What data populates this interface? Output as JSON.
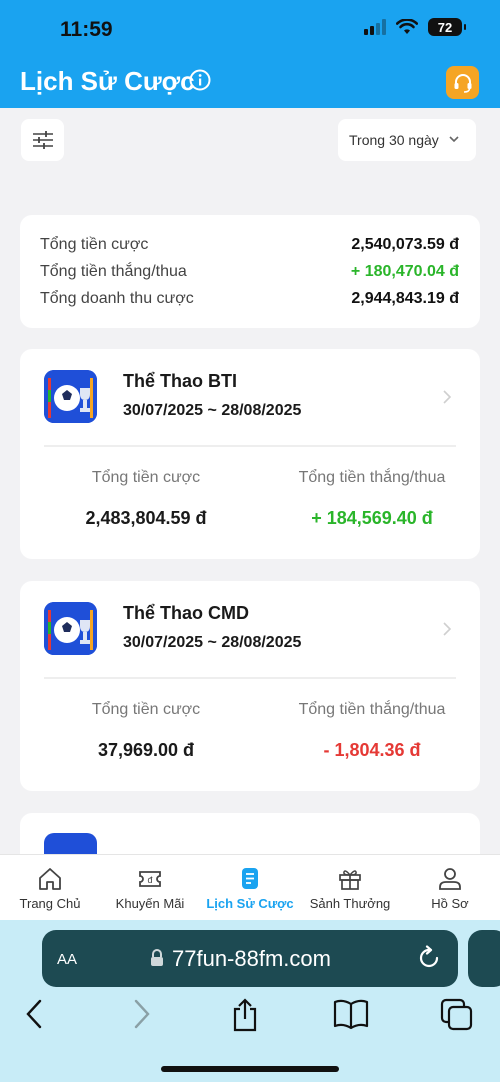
{
  "status_bar": {
    "time": "11:59",
    "battery": "72"
  },
  "header": {
    "title": "Lịch Sử Cược"
  },
  "filter": {
    "range_label": "Trong 30 ngày"
  },
  "summary": {
    "rows": [
      {
        "label": "Tổng tiền cược",
        "value": "2,540,073.59 đ"
      },
      {
        "label": "Tổng tiền thắng/thua",
        "value": "+ 180,470.04 đ"
      },
      {
        "label": "Tổng doanh thu cược",
        "value": "2,944,843.19 đ"
      }
    ]
  },
  "games": [
    {
      "name": "Thể Thao BTI",
      "dates": "30/07/2025 ~ 28/08/2025",
      "bet_label": "Tổng tiền cược",
      "bet_value": "2,483,804.59 đ",
      "winloss_label": "Tổng tiền thắng/thua",
      "winloss_value": "+ 184,569.40 đ"
    },
    {
      "name": "Thể Thao CMD",
      "dates": "30/07/2025 ~ 28/08/2025",
      "bet_label": "Tổng tiền cược",
      "bet_value": "37,969.00 đ",
      "winloss_label": "Tổng tiền thắng/thua",
      "winloss_value": "- 1,804.36 đ"
    }
  ],
  "tabs": [
    {
      "label": "Trang Chủ",
      "icon": "home-icon"
    },
    {
      "label": "Khuyến Mãi",
      "icon": "ticket-icon"
    },
    {
      "label": "Lịch Sử Cược",
      "icon": "document-icon",
      "active": true
    },
    {
      "label": "Sảnh Thưởng",
      "icon": "gift-icon"
    },
    {
      "label": "Hồ Sơ",
      "icon": "user-icon"
    }
  ],
  "browser": {
    "aa_label": "AA",
    "url": "77fun-88fm.com"
  },
  "colors": {
    "primary": "#1aa3f0",
    "positive": "#2ab52a",
    "negative": "#e53935",
    "support": "#f5a524"
  }
}
